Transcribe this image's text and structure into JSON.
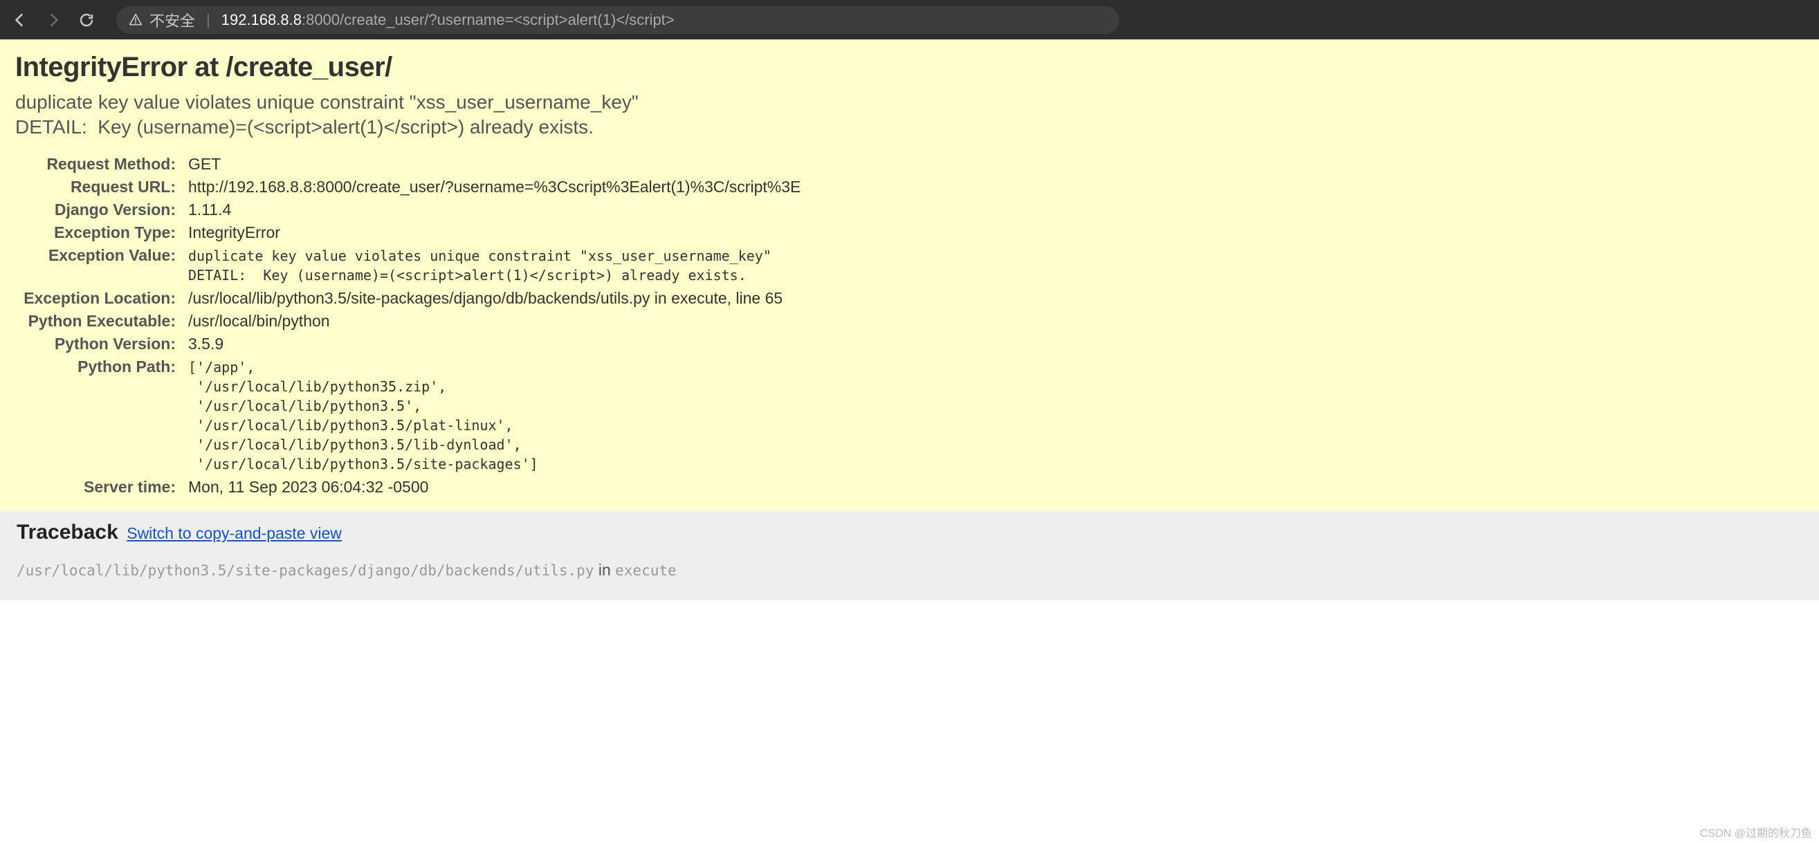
{
  "browser": {
    "security_label": "不安全",
    "url_host": "192.168.8.8",
    "url_port_path": ":8000/create_user/?username=<script>alert(1)</script>"
  },
  "summary": {
    "heading_prefix": "IntegrityError",
    "heading_at": " at ",
    "heading_path": "/create_user/",
    "exception_detail": "duplicate key value violates unique constraint \"xss_user_username_key\"\nDETAIL:  Key (username)=(<script>alert(1)</script>) already exists."
  },
  "meta": {
    "request_method_label": "Request Method:",
    "request_method": "GET",
    "request_url_label": "Request URL:",
    "request_url": "http://192.168.8.8:8000/create_user/?username=%3Cscript%3Ealert(1)%3C/script%3E",
    "django_version_label": "Django Version:",
    "django_version": "1.11.4",
    "exception_type_label": "Exception Type:",
    "exception_type": "IntegrityError",
    "exception_value_label": "Exception Value:",
    "exception_value": "duplicate key value violates unique constraint \"xss_user_username_key\"\nDETAIL:  Key (username)=(<script>alert(1)</script>) already exists.",
    "exception_location_label": "Exception Location:",
    "exception_location": "/usr/local/lib/python3.5/site-packages/django/db/backends/utils.py in execute, line 65",
    "python_executable_label": "Python Executable:",
    "python_executable": "/usr/local/bin/python",
    "python_version_label": "Python Version:",
    "python_version": "3.5.9",
    "python_path_label": "Python Path:",
    "python_path": "['/app',\n '/usr/local/lib/python35.zip',\n '/usr/local/lib/python3.5',\n '/usr/local/lib/python3.5/plat-linux',\n '/usr/local/lib/python3.5/lib-dynload',\n '/usr/local/lib/python3.5/site-packages']",
    "server_time_label": "Server time:",
    "server_time": "Mon, 11 Sep 2023 06:04:32 -0500"
  },
  "traceback": {
    "heading": "Traceback",
    "switch_link": "Switch to copy-and-paste view",
    "frame_path": "/usr/local/lib/python3.5/site-packages/django/db/backends/utils.py",
    "frame_in": " in ",
    "frame_fn": "execute"
  },
  "watermark": "CSDN @过期的秋刀鱼"
}
